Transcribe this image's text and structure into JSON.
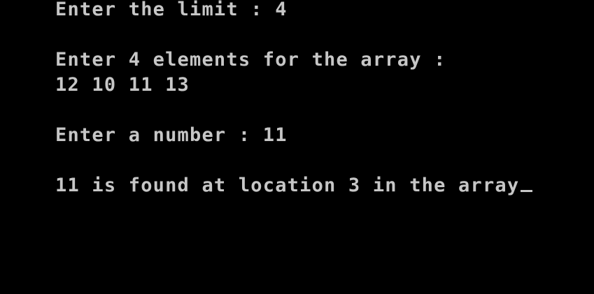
{
  "terminal": {
    "background": "#000000",
    "text_color": "#c6c6c6",
    "lines": [
      "Enter the limit : 4",
      "Enter 4 elements for the array :",
      "12 10 11 13",
      "Enter a number : 11",
      "11 is found at location 3 in the array"
    ],
    "cursor": "_"
  }
}
